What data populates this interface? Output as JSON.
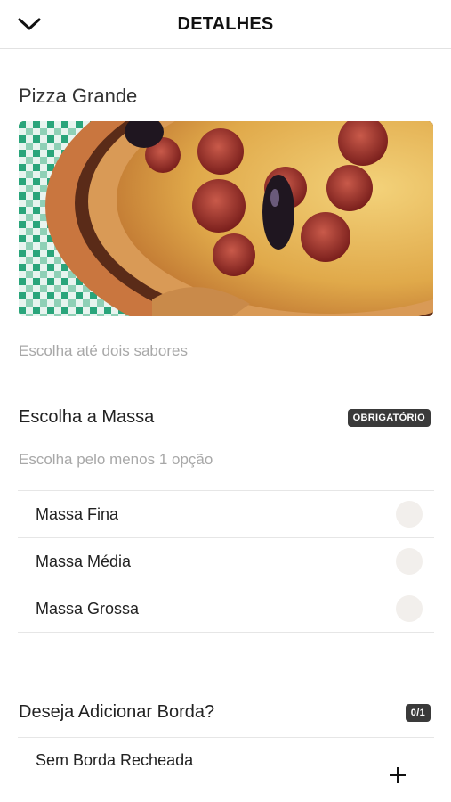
{
  "header": {
    "title": "DETALHES",
    "back_icon": "chevron-down-icon"
  },
  "product": {
    "name": "Pizza Grande",
    "description": "Escolha até dois sabores"
  },
  "massa_section": {
    "title": "Escolha a Massa",
    "badge": "OBRIGATÓRIO",
    "subtitle": "Escolha pelo menos 1 opção",
    "options": [
      {
        "label": "Massa Fina",
        "selected": false
      },
      {
        "label": "Massa Média",
        "selected": false
      },
      {
        "label": "Massa Grossa",
        "selected": false
      }
    ]
  },
  "borda_section": {
    "title": "Deseja Adicionar Borda?",
    "badge": "0/1",
    "options": [
      {
        "label": "Sem Borda Recheada",
        "action_icon": "plus-icon"
      }
    ]
  },
  "colors": {
    "badge_bg": "#3a3a3a",
    "radio_bg": "#f2efec",
    "muted_text": "#a8a8a8"
  }
}
